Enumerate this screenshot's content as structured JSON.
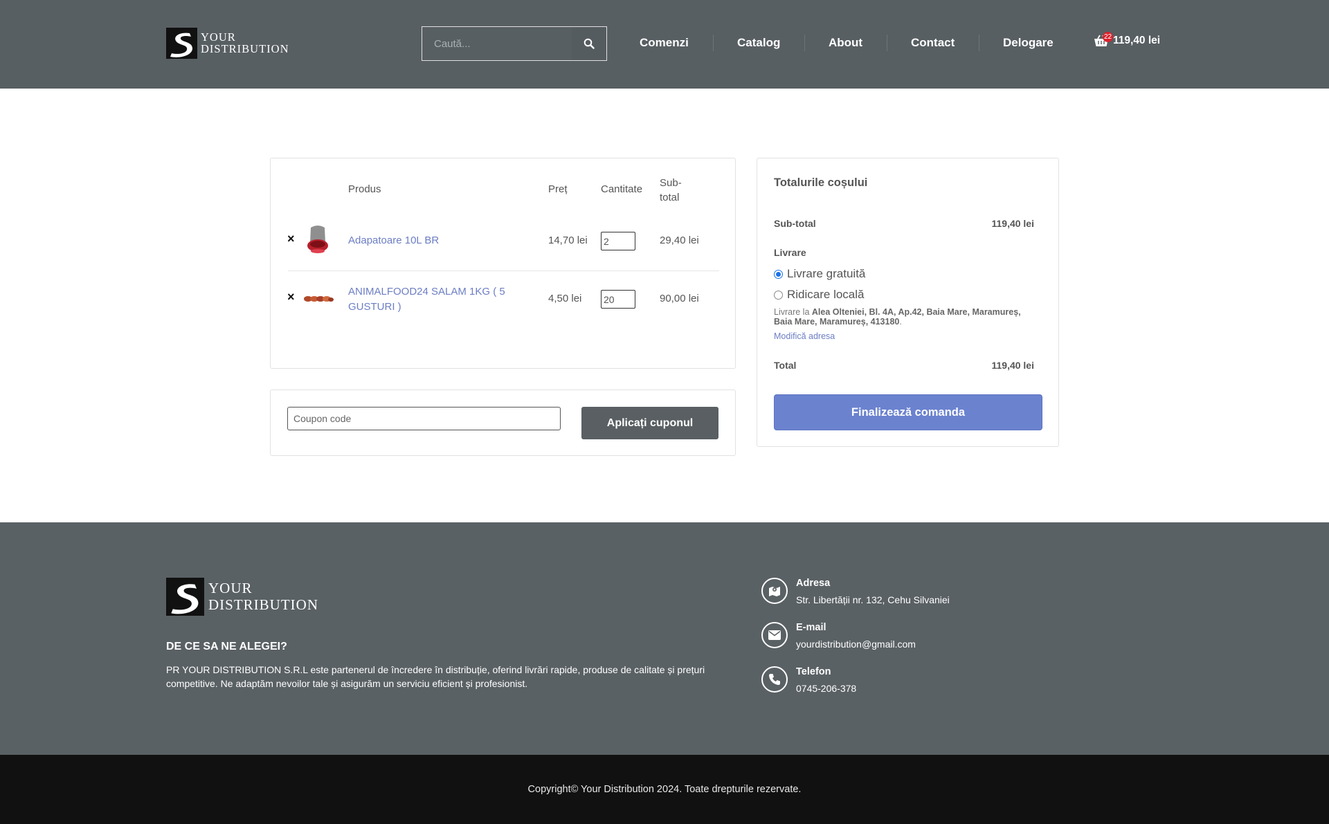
{
  "header": {
    "logo_line1": "YOUR",
    "logo_line2": "DISTRIBUTION",
    "search_placeholder": "Caută...",
    "nav": [
      "Comenzi",
      "Catalog",
      "About",
      "Contact",
      "Delogare"
    ],
    "cart_count": "22",
    "cart_total": "119,40 lei"
  },
  "cart": {
    "headers": {
      "product": "Produs",
      "price": "Preț",
      "quantity": "Cantitate",
      "subtotal_line1": "Sub-",
      "subtotal_line2": "total"
    },
    "remove_symbol": "×",
    "items": [
      {
        "name": "Adapatoare 10L BR",
        "price": "14,70 lei",
        "qty": "2",
        "subtotal": "29,40 lei"
      },
      {
        "name_line1": "ANIMALFOOD24 SALAM 1KG ( 5",
        "name_line2": "GUSTURI )",
        "price": "4,50 lei",
        "qty": "20",
        "subtotal": "90,00 lei"
      }
    ]
  },
  "coupon": {
    "placeholder": "Coupon code",
    "button": "Aplicați cuponul"
  },
  "totals": {
    "title": "Totalurile coșului",
    "subtotal_label": "Sub-total",
    "subtotal_value": "119,40 lei",
    "shipping_label": "Livrare",
    "shipping_options": [
      "Livrare gratuită",
      "Ridicare locală"
    ],
    "shipping_selected": 0,
    "ship_prefix": "Livrare la ",
    "ship_address_line1": "Alea Olteniei, Bl. 4A, Ap.42, Baia Mare, Maramureș,",
    "ship_address_line2": "Baia Mare, Maramureș, 413180",
    "ship_suffix": ".",
    "change_address": "Modifică adresa",
    "total_label": "Total",
    "total_value": "119,40 lei",
    "checkout_button": "Finalizează comanda"
  },
  "footer": {
    "logo_line1": "YOUR",
    "logo_line2": "DISTRIBUTION",
    "heading": "DE CE SA NE ALEGEI?",
    "text": "PR YOUR DISTRIBUTION S.R.L este partenerul de încredere în distribuție, oferind livrări rapide, produse de calitate și prețuri competitive. Ne adaptăm nevoilor tale și asigurăm un serviciu eficient și profesionist.",
    "contacts": [
      {
        "label": "Adresa",
        "value": "Str. Libertății nr. 132, Cehu Silvaniei",
        "icon": "map-icon"
      },
      {
        "label": "E-mail",
        "value": "yourdistribution@gmail.com",
        "icon": "envelope-icon"
      },
      {
        "label": "Telefon",
        "value": "0745-206-378",
        "icon": "phone-icon"
      }
    ],
    "copyright": "Copyright© Your Distribution 2024. Toate drepturile rezervate."
  },
  "colors": {
    "header_bg": "#585f63",
    "footer_bg": "#5a6164",
    "bottom_bg": "#111111",
    "link": "#6c7ec4",
    "checkout": "#6b82cf",
    "badge": "#d9232d"
  }
}
